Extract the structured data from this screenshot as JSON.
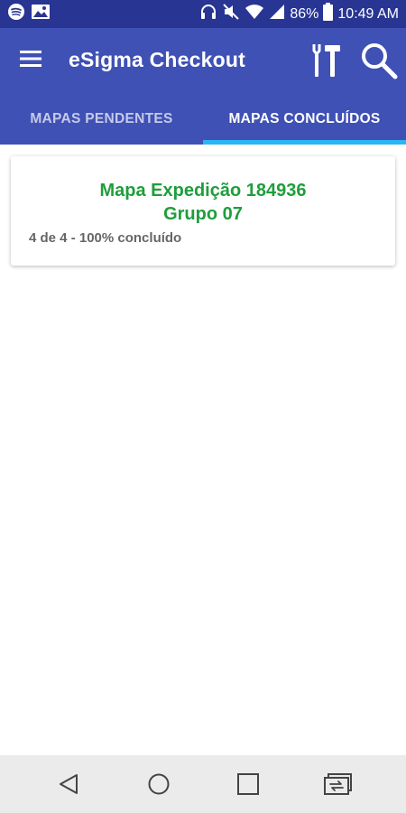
{
  "status_bar": {
    "battery": "86%",
    "time": "10:49 AM",
    "icons": [
      "spotify-icon",
      "gallery-notification-icon",
      "headphones-icon",
      "mute-icon",
      "wifi-icon",
      "signal-icon",
      "battery-icon"
    ]
  },
  "app_bar": {
    "title": "eSigma Checkout",
    "menu_icon": "hamburger-menu-icon",
    "tools_icon": "tools-icon",
    "search_icon": "search-icon"
  },
  "tabs": [
    {
      "label": "MAPAS PENDENTES",
      "active": false
    },
    {
      "label": "MAPAS CONCLUÍDOS",
      "active": true
    }
  ],
  "maps": [
    {
      "title_line1": "Mapa Expedição 184936",
      "title_line2": "Grupo 07",
      "progress": "4 de 4 - 100% concluído"
    }
  ],
  "nav_bar": {
    "icons": [
      "back-icon",
      "home-icon",
      "recents-icon",
      "switch-app-icon"
    ]
  },
  "colors": {
    "status_bar": "#283593",
    "app_bar": "#3f51b5",
    "tab_indicator": "#29b6f6",
    "card_title": "#1e9e3c",
    "card_progress": "#666666",
    "nav_bar": "#ebebeb"
  }
}
